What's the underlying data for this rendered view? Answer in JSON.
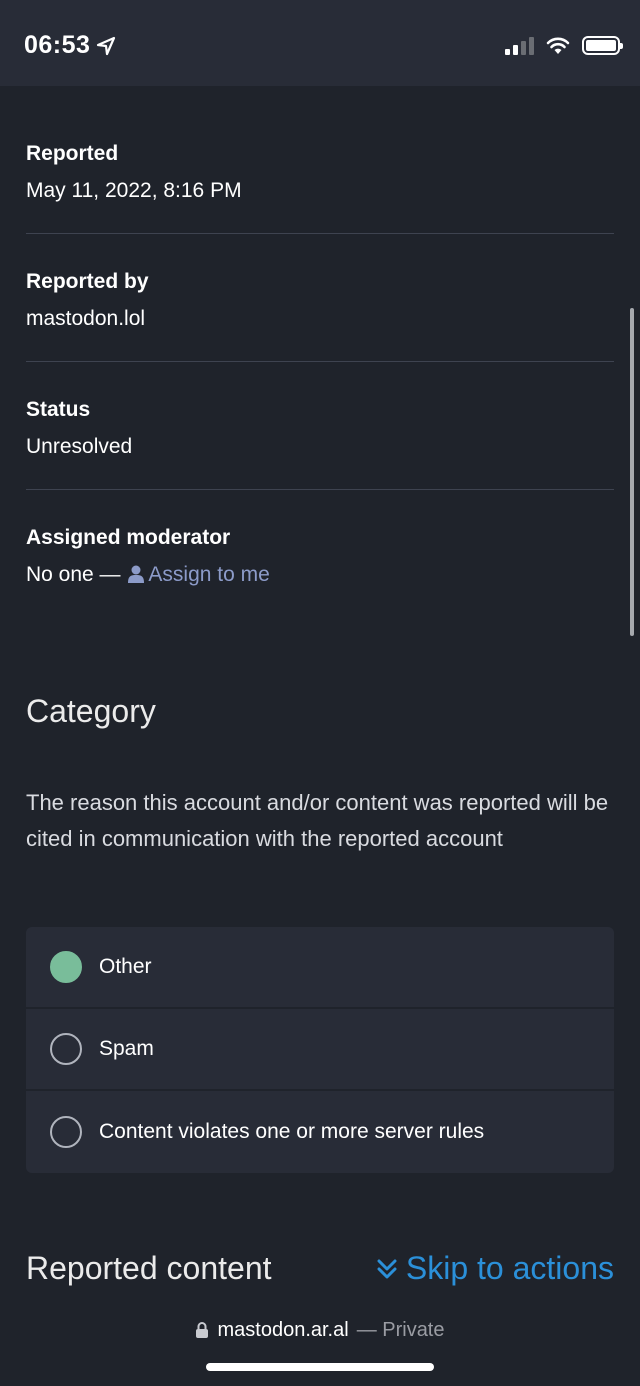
{
  "status_bar": {
    "time": "06:53",
    "icons": [
      "location-arrow-icon",
      "cellular-signal-icon",
      "wifi-icon",
      "battery-icon"
    ]
  },
  "report": {
    "reported_label": "Reported",
    "reported_value": "May 11, 2022, 8:16 PM",
    "reported_by_label": "Reported by",
    "reported_by_value": "mastodon.lol",
    "status_label": "Status",
    "status_value": "Unresolved",
    "moderator_label": "Assigned moderator",
    "moderator_value": "No one —",
    "assign_link": "Assign to me"
  },
  "category": {
    "heading": "Category",
    "description": "The reason this account and/or content was reported will be cited in communication with the reported account",
    "options": [
      {
        "label": "Other",
        "checked": true
      },
      {
        "label": "Spam",
        "checked": false
      },
      {
        "label": "Content violates one or more server rules",
        "checked": false
      }
    ]
  },
  "reported_content": {
    "heading": "Reported content",
    "skip_link": "Skip to actions"
  },
  "browser": {
    "domain": "mastodon.ar.al",
    "privacy": "— Private"
  },
  "colors": {
    "background": "#1f232b",
    "accent_link": "#2b90d9",
    "muted_link": "#8c9bc9",
    "radio_checked": "#79bd9a"
  }
}
